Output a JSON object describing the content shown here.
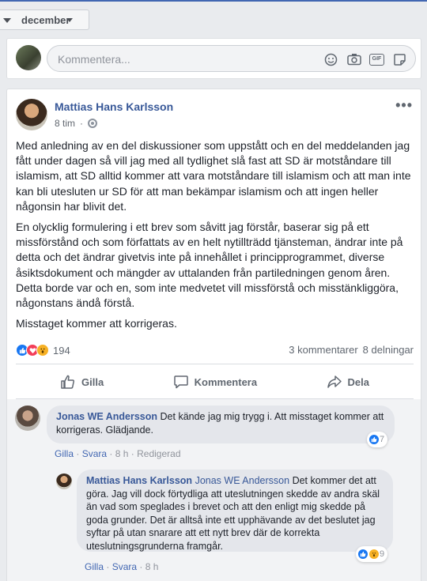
{
  "month_selector": {
    "label": "december"
  },
  "composer": {
    "placeholder": "Kommentera..."
  },
  "post": {
    "author": "Mattias Hans Karlsson",
    "time": "8 tim",
    "more": "•••",
    "paragraphs": [
      "Med anledning av en del diskussioner som uppstått och en del meddelanden jag fått under dagen så vill jag med all tydlighet slå fast att SD är motståndare till islamism, att SD alltid kommer att vara motståndare till islamism och att man inte kan bli utesluten ur SD för att man bekämpar islamism och att ingen heller någonsin har blivit det.",
      "En olycklig formulering i ett brev som såvitt jag förstår, baserar sig på ett missförstånd och som författats av en helt nytillträdd tjänsteman, ändrar inte på detta och det ändrar givetvis inte på innehållet i principprogrammet, diverse åsiktsdokument och mängder av uttalanden från partiledningen genom åren. Detta borde var och en, som inte medvetet vill missförstå och misstänkliggöra, någonstans ändå förstå.",
      "Misstaget kommer att korrigeras."
    ],
    "reaction_count": "194",
    "comments_count": "3 kommentarer",
    "shares_count": "8 delningar",
    "actions": {
      "like": "Gilla",
      "comment": "Kommentera",
      "share": "Dela"
    }
  },
  "comments": [
    {
      "author": "Jonas WE Andersson",
      "text": "Det kände jag mig trygg i. Att misstaget kommer att korrigeras. Glädjande.",
      "like": "Gilla",
      "reply": "Svara",
      "time": "8 h",
      "edited": "Redigerad",
      "reactions": "7"
    },
    {
      "author": "Mattias Hans Karlsson",
      "tag": "Jonas WE Andersson",
      "text": "Det kommer det att göra. Jag vill dock förtydliga att uteslutningen skedde av andra skäl än vad som speglades i brevet och att den enligt mig skedde på goda grunder. Det är alltså inte ett upphävande av det beslutet jag syftar på utan snarare att ett nytt brev där de korrekta uteslutningsgrunderna framgår.",
      "like": "Gilla",
      "reply": "Svara",
      "time": "8 h",
      "reactions": "9"
    }
  ],
  "separator": "·",
  "colors": {
    "link": "#385898",
    "accent": "#4267b2",
    "text": "#1d2129",
    "muted": "#606770"
  }
}
